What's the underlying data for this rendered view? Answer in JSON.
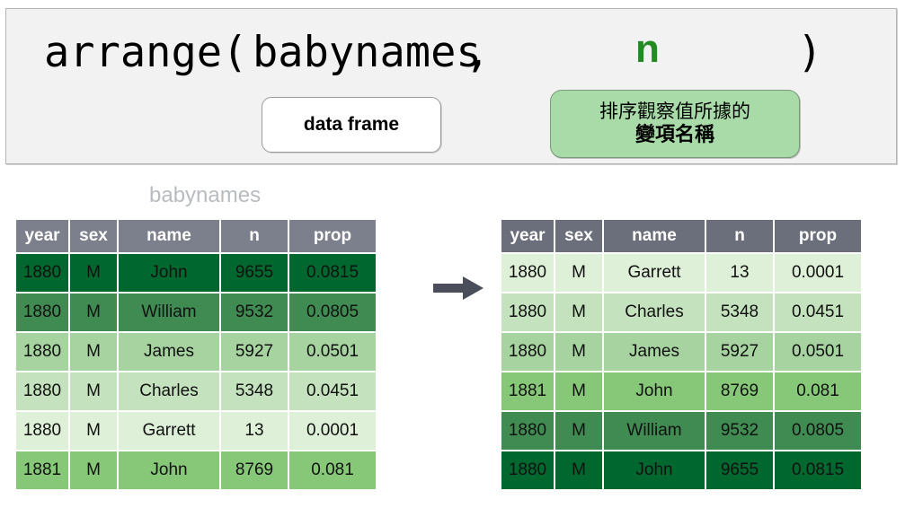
{
  "formula": {
    "function_name": "arrange(",
    "data_frame_arg": "babynames",
    "separator": ",",
    "second_arg": "n",
    "closing_paren": ")",
    "accent_color": "#228b22",
    "panel_bg": "#f2f2f2"
  },
  "callouts": {
    "data_frame": {
      "label": "data frame",
      "bg": "#ffffff"
    },
    "variable": {
      "line1": "排序觀察值所據的",
      "line2": "變項名稱",
      "bg": "#a8dba8"
    }
  },
  "arrow": {
    "icon": "right-arrow-icon",
    "color": "#4a4e5a"
  },
  "tables": {
    "left": {
      "title": "babynames",
      "title_color": "#b8bcc0",
      "header_bg": "#7c7f8c",
      "columns": [
        "year",
        "sex",
        "name",
        "n",
        "prop"
      ],
      "rows": [
        {
          "cells": [
            "1880",
            "M",
            "John",
            "9655",
            "0.0815"
          ],
          "bg": "#00682e"
        },
        {
          "cells": [
            "1880",
            "M",
            "William",
            "9532",
            "0.0805"
          ],
          "bg": "#3f8b52"
        },
        {
          "cells": [
            "1880",
            "M",
            "James",
            "5927",
            "0.0501"
          ],
          "bg": "#a6d3a0"
        },
        {
          "cells": [
            "1880",
            "M",
            "Charles",
            "5348",
            "0.0451"
          ],
          "bg": "#c4e2bd"
        },
        {
          "cells": [
            "1880",
            "M",
            "Garrett",
            "13",
            "0.0001"
          ],
          "bg": "#dff0d8"
        },
        {
          "cells": [
            "1881",
            "M",
            "John",
            "8769",
            "0.081"
          ],
          "bg": "#86c878"
        }
      ]
    },
    "right": {
      "title": "",
      "header_bg": "#6b6e7b",
      "columns": [
        "year",
        "sex",
        "name",
        "n",
        "prop"
      ],
      "rows": [
        {
          "cells": [
            "1880",
            "M",
            "Garrett",
            "13",
            "0.0001"
          ],
          "bg": "#dff0d8"
        },
        {
          "cells": [
            "1880",
            "M",
            "Charles",
            "5348",
            "0.0451"
          ],
          "bg": "#c4e2bd"
        },
        {
          "cells": [
            "1880",
            "M",
            "James",
            "5927",
            "0.0501"
          ],
          "bg": "#a6d3a0"
        },
        {
          "cells": [
            "1881",
            "M",
            "John",
            "8769",
            "0.081"
          ],
          "bg": "#86c878"
        },
        {
          "cells": [
            "1880",
            "M",
            "William",
            "9532",
            "0.0805"
          ],
          "bg": "#3f8b52"
        },
        {
          "cells": [
            "1880",
            "M",
            "John",
            "9655",
            "0.0815"
          ],
          "bg": "#00682e"
        }
      ]
    }
  }
}
